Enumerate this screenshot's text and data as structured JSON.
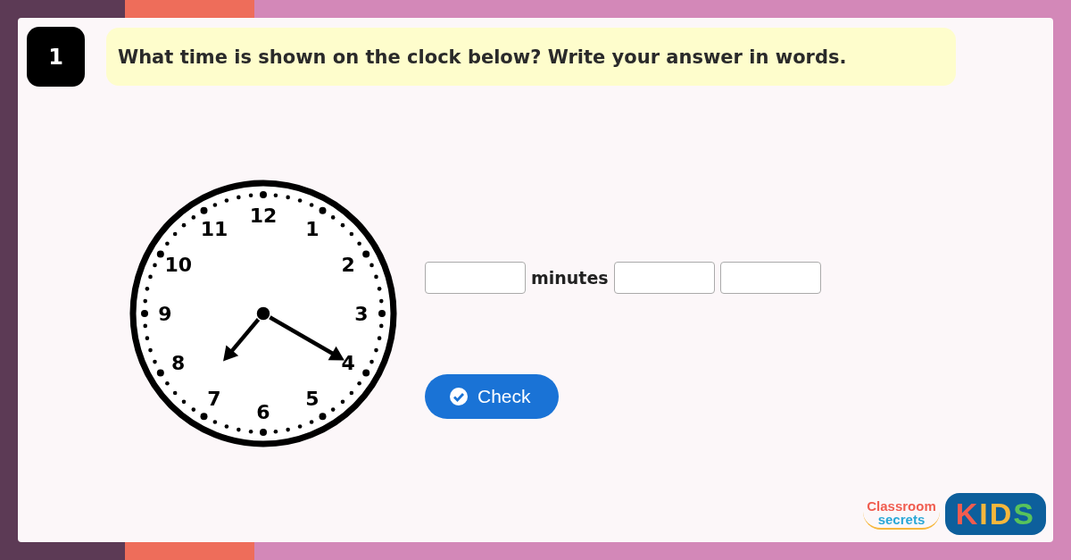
{
  "question": {
    "number": "1",
    "text": "What time is shown on the clock below? Write your answer in words."
  },
  "clock": {
    "numerals": [
      "12",
      "1",
      "2",
      "3",
      "4",
      "5",
      "6",
      "7",
      "8",
      "9",
      "10",
      "11"
    ]
  },
  "answer": {
    "fields": [
      {
        "kind": "input"
      },
      {
        "kind": "label",
        "text": "minutes"
      },
      {
        "kind": "input"
      },
      {
        "kind": "input"
      }
    ]
  },
  "check_button": {
    "label": "Check"
  },
  "logo": {
    "line_1": "Classroom",
    "line_2": "secrets",
    "badge": "KIDS"
  }
}
